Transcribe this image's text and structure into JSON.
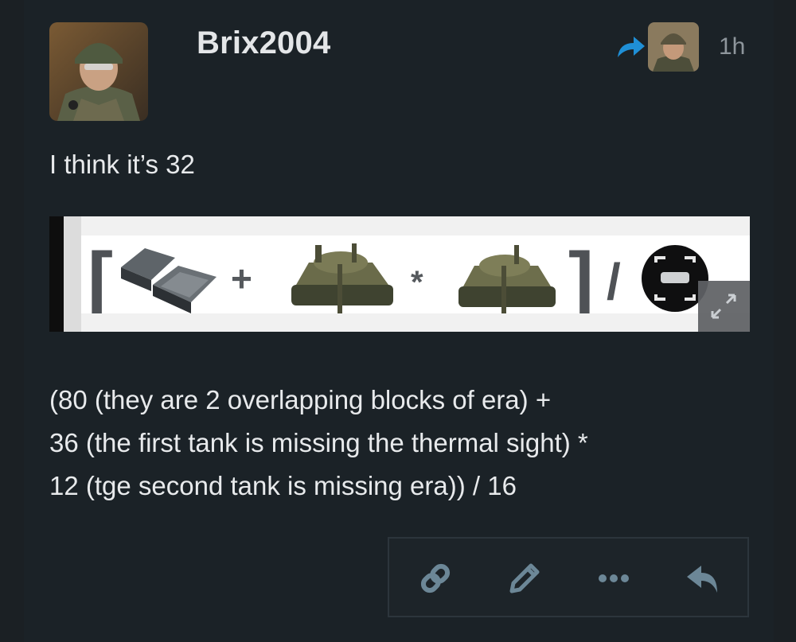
{
  "post": {
    "username": "Brix2004",
    "time": "1h",
    "first_line": "I think it’s 32",
    "image": {
      "operators": [
        "+",
        "*",
        "/"
      ],
      "brackets": [
        "[",
        "]"
      ]
    },
    "body_lines": [
      "(80 (they are 2 overlapping blocks of era) +",
      "36 (the first tank is missing the thermal sight) *",
      "12 (tge second tank is missing era)) / 16"
    ]
  },
  "icons": {
    "reply_to": "reply-arrow-icon",
    "expand": "expand-icon",
    "link": "link-icon",
    "edit": "pencil-icon",
    "more": "ellipsis-icon",
    "reply": "reply-icon"
  },
  "colors": {
    "accent_blue": "#1f8fd6",
    "action_icon": "#6c8797"
  }
}
